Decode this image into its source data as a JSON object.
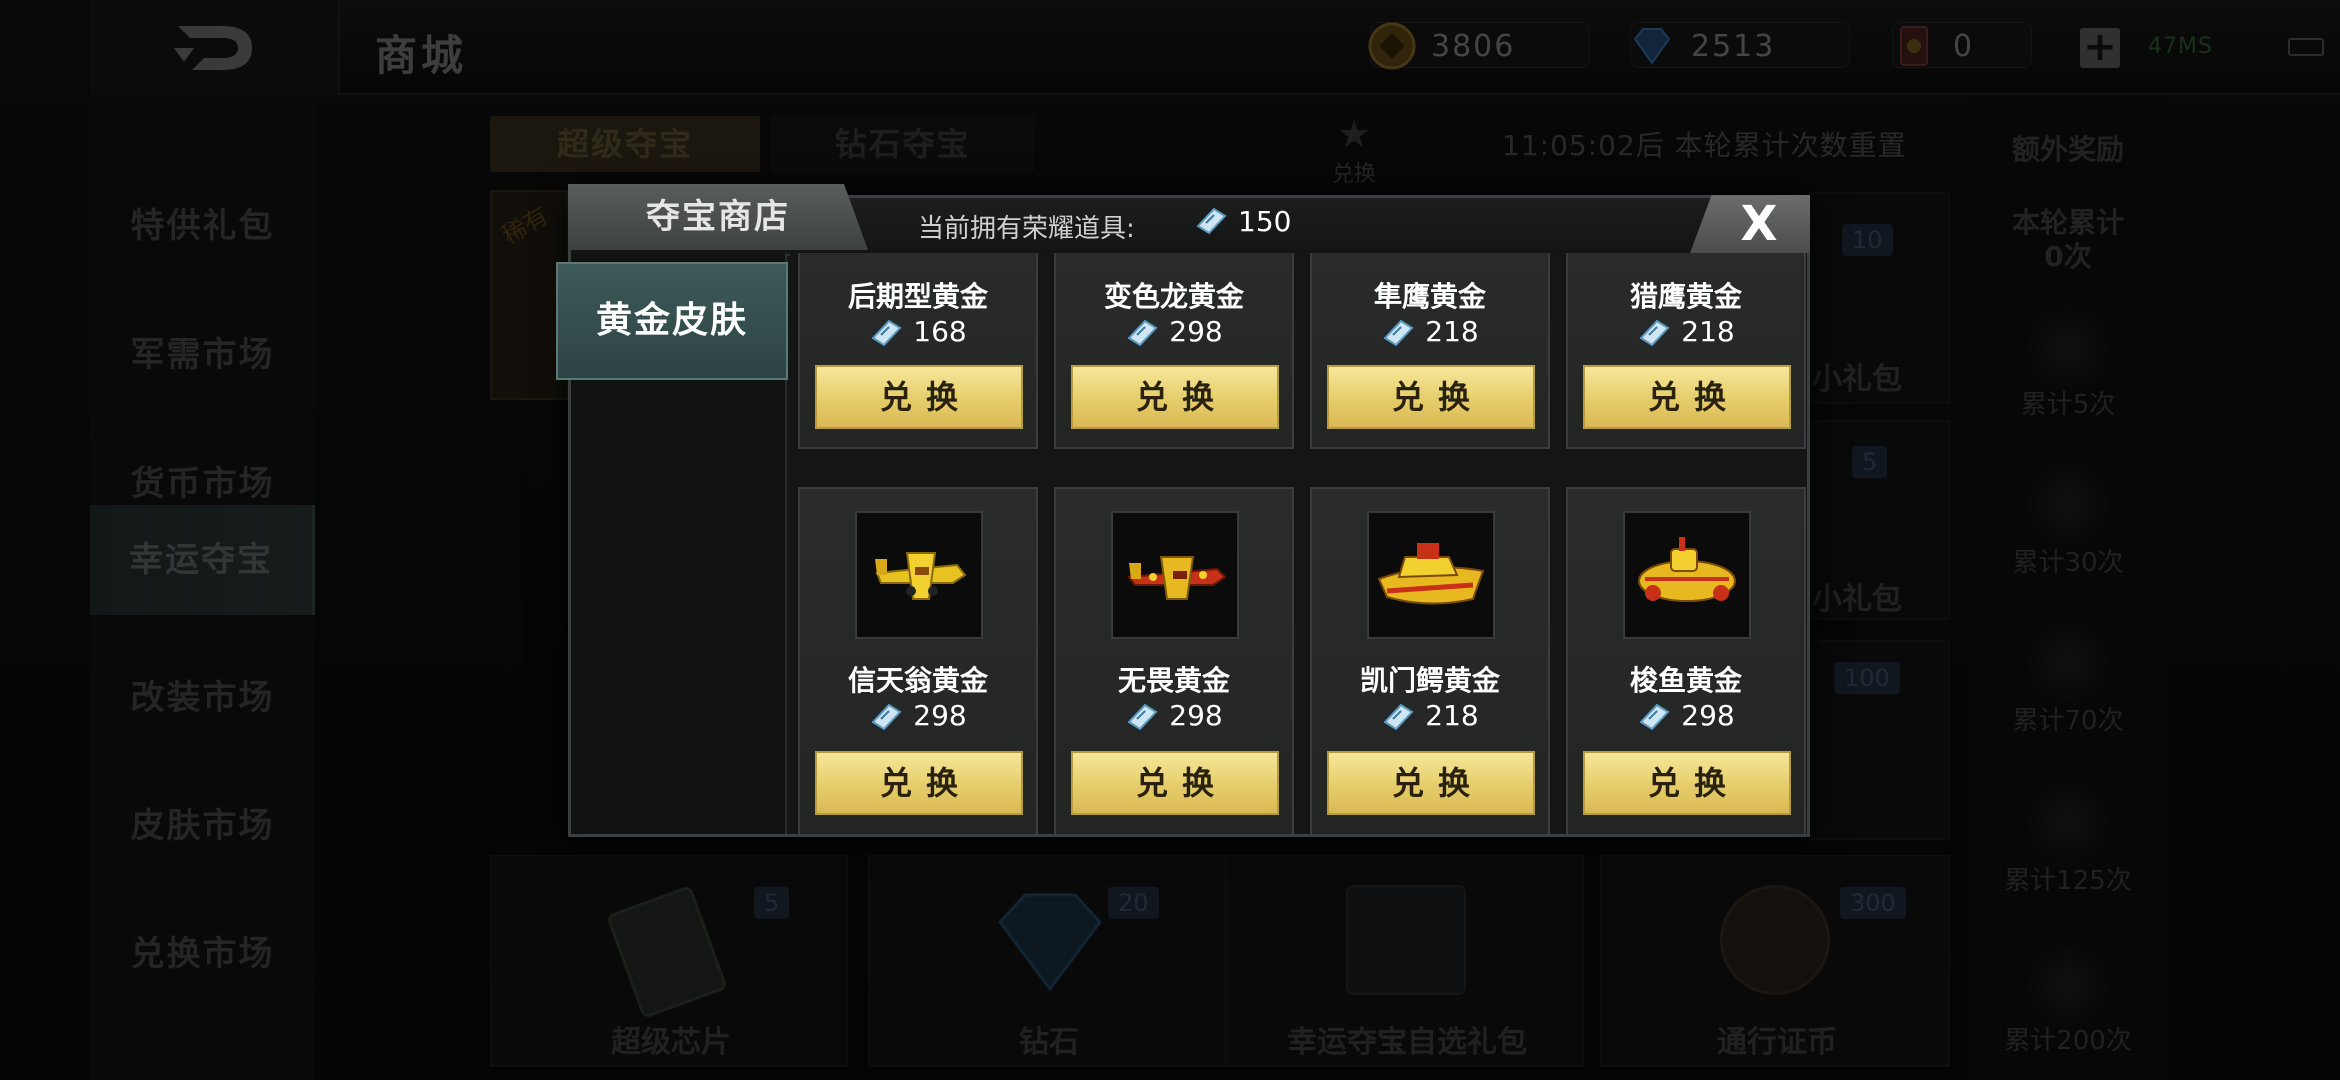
{
  "header": {
    "title": "商城",
    "coins": "3806",
    "diamonds": "2513",
    "tickets": "0",
    "status": "47MS"
  },
  "nav": {
    "items": [
      {
        "label": "特供礼包",
        "active": false
      },
      {
        "label": "军需市场",
        "active": false
      },
      {
        "label": "货币市场",
        "active": false
      },
      {
        "label": "幸运夺宝",
        "active": true
      },
      {
        "label": "改装市场",
        "active": false
      },
      {
        "label": "皮肤市场",
        "active": false
      },
      {
        "label": "兑换市场",
        "active": false
      }
    ]
  },
  "background": {
    "tab1": "超级夺宝",
    "tab2": "钻石夺宝",
    "timer": "11:05:02后 本轮累计次数重置",
    "exchange_label": "兑换",
    "badge_hot": "稀有",
    "right_panel": {
      "title": "额外奖励",
      "subtitle": "本轮累计",
      "count": "0次",
      "milestones": [
        "累计5次",
        "累计30次",
        "累计70次",
        "累计125次",
        "累计200次"
      ]
    },
    "cards": [
      {
        "label": "超级芯片",
        "badge": "5"
      },
      {
        "label": "钻石",
        "badge": "20"
      },
      {
        "label": "幸运夺宝自选礼包",
        "badge": ""
      },
      {
        "label": "通行证币",
        "badge": "300"
      }
    ],
    "side_badges": [
      "10",
      "5",
      "100"
    ],
    "side_labels": [
      "小礼包",
      "小礼包"
    ]
  },
  "modal": {
    "title": "夺宝商店",
    "owned_label": "当前拥有荣耀道具:",
    "owned_value": "150",
    "close_label": "X",
    "category": "黄金皮肤",
    "items": [
      {
        "name": "后期型黄金",
        "price": "168",
        "button": "兑换"
      },
      {
        "name": "变色龙黄金",
        "price": "298",
        "button": "兑换"
      },
      {
        "name": "隼鹰黄金",
        "price": "218",
        "button": "兑换"
      },
      {
        "name": "猎鹰黄金",
        "price": "218",
        "button": "兑换"
      },
      {
        "name": "信天翁黄金",
        "price": "298",
        "button": "兑换",
        "image": "gold-plane-yellow"
      },
      {
        "name": "无畏黄金",
        "price": "298",
        "button": "兑换",
        "image": "gold-plane-red"
      },
      {
        "name": "凯门鳄黄金",
        "price": "218",
        "button": "兑换",
        "image": "gold-boat"
      },
      {
        "name": "梭鱼黄金",
        "price": "298",
        "button": "兑换",
        "image": "gold-submarine"
      }
    ]
  },
  "colors": {
    "gold_button": "#e6cd6a",
    "active_category": "#3d5a58",
    "modal_bg": "#151717"
  }
}
